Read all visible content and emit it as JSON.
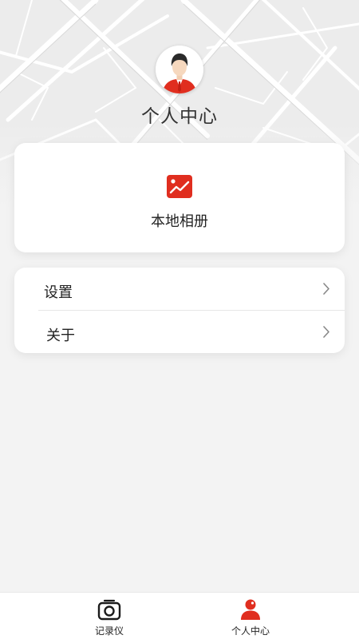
{
  "header": {
    "title": "个人中心",
    "avatar_icon": "user-avatar-icon"
  },
  "album_card": {
    "label": "本地相册",
    "icon": "photo-album-icon"
  },
  "menu": {
    "items": [
      {
        "label": "设置",
        "icon": "chevron-right-icon"
      },
      {
        "label": "关于",
        "icon": "chevron-right-icon"
      }
    ]
  },
  "tabbar": {
    "tabs": [
      {
        "label": "记录仪",
        "icon": "camera-icon",
        "selected": false
      },
      {
        "label": "个人中心",
        "icon": "person-icon",
        "selected": true
      }
    ]
  },
  "colors": {
    "accent": "#e02e1f",
    "background": "#f3f3f3",
    "card": "#ffffff",
    "text": "#222222"
  }
}
